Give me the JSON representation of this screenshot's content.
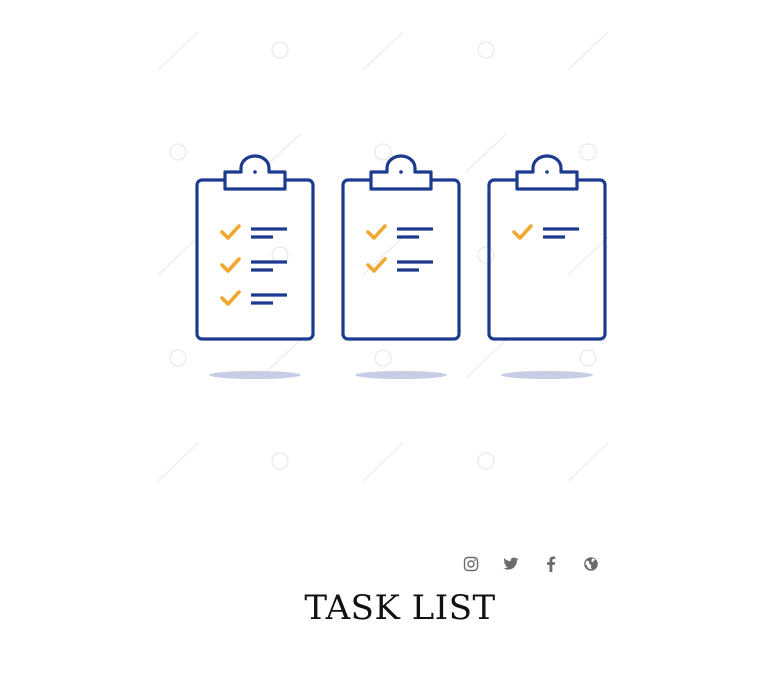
{
  "illustration": {
    "stroke_color": "#1c3a8f",
    "check_color": "#f0a830",
    "shadow_color": "#c8cde6",
    "clipboards": [
      {
        "checked_items": 3
      },
      {
        "checked_items": 2
      },
      {
        "checked_items": 1
      }
    ]
  },
  "social": {
    "icon_color": "#6b6b6b",
    "icons": [
      "instagram-icon",
      "twitter-icon",
      "facebook-icon",
      "globe-icon"
    ]
  },
  "title": "TASK LIST"
}
